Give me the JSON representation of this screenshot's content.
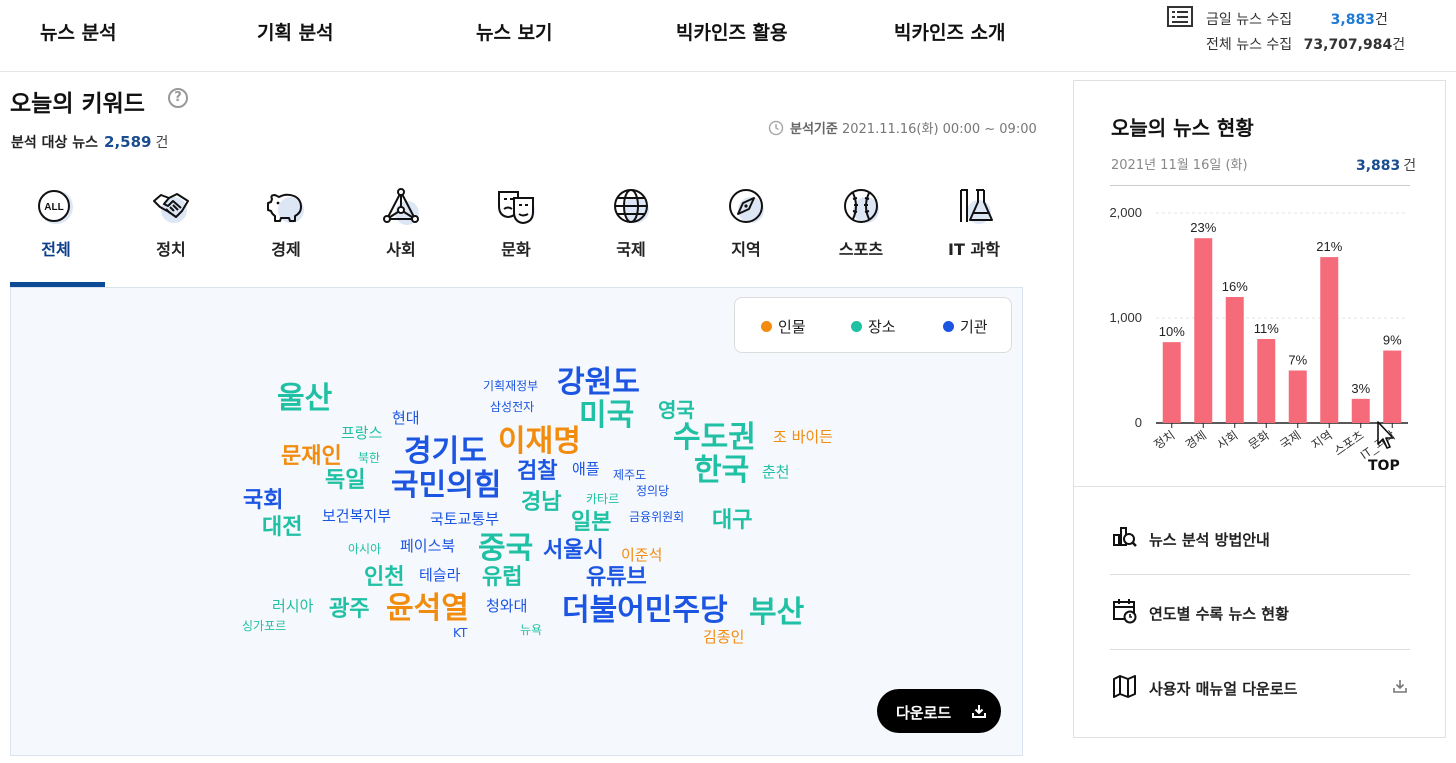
{
  "nav": {
    "items": [
      "뉴스 분석",
      "기획 분석",
      "뉴스 보기",
      "빅카인즈 활용",
      "빅카인즈 소개"
    ]
  },
  "counts": {
    "today_label": "금일 뉴스 수집",
    "today_value": "3,883",
    "total_label": "전체 뉴스 수집",
    "total_value": "73,707,984",
    "unit": "건"
  },
  "keywords": {
    "title": "오늘의 키워드",
    "help": "?",
    "analysis_label": "분석 대상 뉴스",
    "analysis_value": "2,589",
    "analysis_unit": "건",
    "basis_label": "분석기준",
    "basis_value": "2021.11.16(화) 00:00 ~ 09:00"
  },
  "categories": [
    {
      "label": "전체",
      "icon": "all-icon",
      "active": true
    },
    {
      "label": "정치",
      "icon": "handshake-icon"
    },
    {
      "label": "경제",
      "icon": "piggy-bank-icon"
    },
    {
      "label": "사회",
      "icon": "network-icon"
    },
    {
      "label": "문화",
      "icon": "theater-masks-icon"
    },
    {
      "label": "국제",
      "icon": "globe-icon"
    },
    {
      "label": "지역",
      "icon": "compass-icon"
    },
    {
      "label": "스포츠",
      "icon": "baseball-icon"
    },
    {
      "label": "IT 과학",
      "icon": "flask-icon"
    }
  ],
  "legend": [
    {
      "label": "인물",
      "color": "#f28c0f"
    },
    {
      "label": "장소",
      "color": "#20c0a4"
    },
    {
      "label": "기관",
      "color": "#1b55e2"
    }
  ],
  "colors": {
    "person": "#f28c0f",
    "place": "#20c0a4",
    "org": "#1b55e2",
    "bar": "#f56b7a",
    "accent": "#0b4a95"
  },
  "wordcloud": [
    {
      "text": "강원도",
      "type": "org"
    },
    {
      "text": "기획재정부",
      "type": "org"
    },
    {
      "text": "삼성전자",
      "type": "org"
    },
    {
      "text": "울산",
      "type": "place"
    },
    {
      "text": "미국",
      "type": "place"
    },
    {
      "text": "영국",
      "type": "place"
    },
    {
      "text": "현대",
      "type": "org"
    },
    {
      "text": "프랑스",
      "type": "place"
    },
    {
      "text": "수도권",
      "type": "place"
    },
    {
      "text": "조 바이든",
      "type": "person"
    },
    {
      "text": "경기도",
      "type": "org"
    },
    {
      "text": "이재명",
      "type": "person"
    },
    {
      "text": "문재인",
      "type": "person"
    },
    {
      "text": "북한",
      "type": "place"
    },
    {
      "text": "애플",
      "type": "org"
    },
    {
      "text": "제주도",
      "type": "org"
    },
    {
      "text": "한국",
      "type": "place"
    },
    {
      "text": "춘천",
      "type": "place"
    },
    {
      "text": "검찰",
      "type": "org"
    },
    {
      "text": "독일",
      "type": "place"
    },
    {
      "text": "국민의힘",
      "type": "org"
    },
    {
      "text": "정의당",
      "type": "org"
    },
    {
      "text": "국회",
      "type": "org"
    },
    {
      "text": "카타르",
      "type": "place"
    },
    {
      "text": "경남",
      "type": "place"
    },
    {
      "text": "보건복지부",
      "type": "org"
    },
    {
      "text": "국토교통부",
      "type": "org"
    },
    {
      "text": "금융위원회",
      "type": "org"
    },
    {
      "text": "대전",
      "type": "place"
    },
    {
      "text": "일본",
      "type": "place"
    },
    {
      "text": "대구",
      "type": "place"
    },
    {
      "text": "아시아",
      "type": "place"
    },
    {
      "text": "페이스북",
      "type": "org"
    },
    {
      "text": "중국",
      "type": "place"
    },
    {
      "text": "서울시",
      "type": "org"
    },
    {
      "text": "이준석",
      "type": "person"
    },
    {
      "text": "인천",
      "type": "place"
    },
    {
      "text": "테슬라",
      "type": "org"
    },
    {
      "text": "유럽",
      "type": "place"
    },
    {
      "text": "유튜브",
      "type": "org"
    },
    {
      "text": "러시아",
      "type": "place"
    },
    {
      "text": "광주",
      "type": "place"
    },
    {
      "text": "윤석열",
      "type": "person"
    },
    {
      "text": "청와대",
      "type": "org"
    },
    {
      "text": "더불어민주당",
      "type": "org"
    },
    {
      "text": "부산",
      "type": "place"
    },
    {
      "text": "싱가포르",
      "type": "place"
    },
    {
      "text": "KT",
      "type": "org"
    },
    {
      "text": "뉴욕",
      "type": "place"
    },
    {
      "text": "김종인",
      "type": "person"
    }
  ],
  "download": {
    "label": "다운로드"
  },
  "today_news": {
    "title": "오늘의 뉴스 현황",
    "date": "2021년 11월 16일 (화)",
    "total": "3,883",
    "unit": "건"
  },
  "chart_data": {
    "type": "bar",
    "categories": [
      "정치",
      "경제",
      "사회",
      "문화",
      "국제",
      "지역",
      "스포츠",
      "IT_과학"
    ],
    "values": [
      770,
      1760,
      1200,
      800,
      500,
      1580,
      230,
      690
    ],
    "data_labels": [
      "10%",
      "23%",
      "16%",
      "11%",
      "7%",
      "21%",
      "3%",
      "9%"
    ],
    "yticks": [
      "2,000",
      "1,000",
      "0"
    ],
    "ylim": [
      0,
      2000
    ],
    "grid": true
  },
  "side_menu": [
    {
      "label": "뉴스 분석 방법안내",
      "icon": "chart-magnifier-icon"
    },
    {
      "label": "연도별 수록 뉴스 현황",
      "icon": "calendar-clock-icon"
    },
    {
      "label": "사용자 매뉴얼 다운로드",
      "icon": "map-icon",
      "download": true
    }
  ],
  "top_button": {
    "label": "TOP"
  }
}
